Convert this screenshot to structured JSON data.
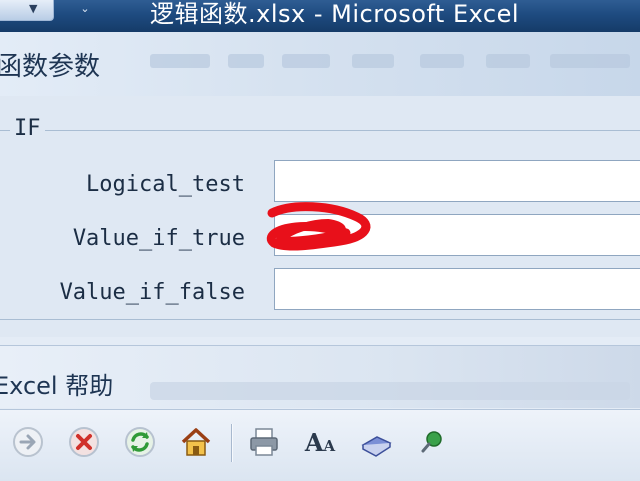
{
  "titlebar": {
    "window_title": "逻辑函数.xlsx - Microsoft Excel",
    "qat_dropdown_glyph": "▼",
    "qat_customize_glyph": "⌄"
  },
  "dialog": {
    "title": "函数参数",
    "function_name": "IF",
    "arguments": [
      {
        "label": "Logical_test",
        "value": ""
      },
      {
        "label": "Value_if_true",
        "value": ""
      },
      {
        "label": "Value_if_false",
        "value": ""
      }
    ],
    "annotation_color": "#e8101a"
  },
  "help": {
    "title": "Excel 帮助",
    "toolbar": [
      {
        "icon": "forward-arrow-icon"
      },
      {
        "icon": "stop-icon"
      },
      {
        "icon": "refresh-icon"
      },
      {
        "icon": "home-icon"
      },
      {
        "icon": "print-icon"
      },
      {
        "icon": "text-size-icon",
        "glyph": "A"
      },
      {
        "icon": "book-icon"
      },
      {
        "icon": "pushpin-icon"
      }
    ]
  },
  "colors": {
    "titlebar": "#1e4b80",
    "dialog_bg": "#dfe8f3",
    "text": "#1b2d44",
    "annotation": "#e8101a"
  }
}
